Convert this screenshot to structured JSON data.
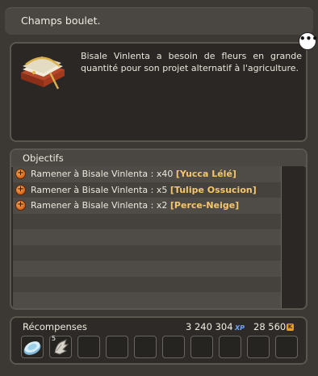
{
  "window": {
    "title": "Champs boulet."
  },
  "description": {
    "text": "Bisale Vinlenta a besoin de fleurs en grande quantité pour son projet alternatif à l'agriculture."
  },
  "objectives": {
    "header": "Objectifs",
    "items": [
      {
        "prefix": "Ramener à Bisale Vinlenta : x40 ",
        "item": "[Yucca Lélé]"
      },
      {
        "prefix": "Ramener à Bisale Vinlenta : x5 ",
        "item": "[Tulipe Ossucion]"
      },
      {
        "prefix": "Ramener à Bisale Vinlenta : x2 ",
        "item": "[Perce-Neige]"
      }
    ]
  },
  "rewards": {
    "label": "Récompenses",
    "xp": "3 240 304",
    "xp_unit": "XP",
    "kamas": "28 560",
    "kamas_unit": "K",
    "slots": [
      {
        "icon": "silver-coin-icon",
        "qty": ""
      },
      {
        "icon": "claw-item-icon",
        "qty": "5"
      },
      {
        "icon": "",
        "qty": ""
      },
      {
        "icon": "",
        "qty": ""
      },
      {
        "icon": "",
        "qty": ""
      },
      {
        "icon": "",
        "qty": ""
      },
      {
        "icon": "",
        "qty": ""
      },
      {
        "icon": "",
        "qty": ""
      },
      {
        "icon": "",
        "qty": ""
      },
      {
        "icon": "",
        "qty": ""
      }
    ]
  },
  "colors": {
    "item_highlight": "#f5c66a",
    "xp_tag": "#6fa8ff"
  }
}
